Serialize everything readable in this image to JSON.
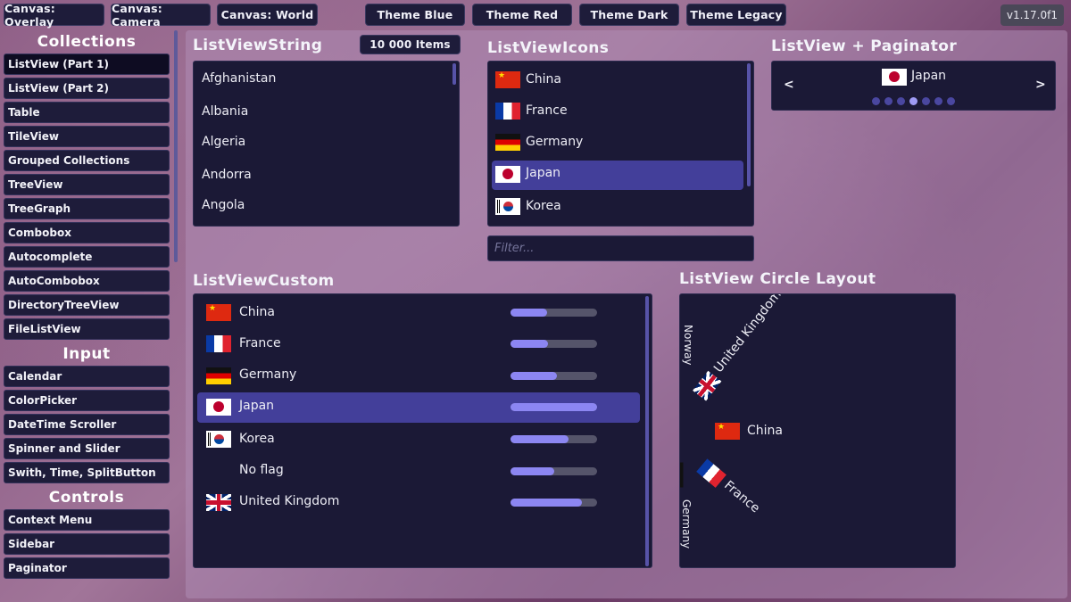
{
  "topbar": {
    "canvas_buttons": [
      "Canvas: Overlay",
      "Canvas: Camera",
      "Canvas: World"
    ],
    "theme_buttons": [
      "Theme Blue",
      "Theme Red",
      "Theme Dark",
      "Theme Legacy"
    ],
    "version": "v1.17.0f1"
  },
  "sidebar": {
    "collections_title": "Collections",
    "collections": [
      "ListView (Part 1)",
      "ListView (Part 2)",
      "Table",
      "TileView",
      "Grouped Collections",
      "TreeView",
      "TreeGraph",
      "Combobox",
      "Autocomplete",
      "AutoCombobox",
      "DirectoryTreeView",
      "FileListView"
    ],
    "input_title": "Input",
    "input": [
      "Calendar",
      "ColorPicker",
      "DateTime Scroller",
      "Spinner and Slider",
      "Swith, Time, SplitButton"
    ],
    "controls_title": "Controls",
    "controls": [
      "Context Menu",
      "Sidebar",
      "Paginator"
    ],
    "selected": "ListView (Part 1)"
  },
  "lv_string": {
    "title": "ListViewString",
    "items_button": "10 000 Items",
    "items": [
      "Afghanistan",
      "Albania",
      "Algeria",
      "Andorra",
      "Angola"
    ]
  },
  "lv_icons": {
    "title": "ListViewIcons",
    "items": [
      {
        "name": "China",
        "flag": "cn"
      },
      {
        "name": "France",
        "flag": "fr"
      },
      {
        "name": "Germany",
        "flag": "de"
      },
      {
        "name": "Japan",
        "flag": "jp"
      },
      {
        "name": "Korea",
        "flag": "kr"
      }
    ],
    "selected": "Japan",
    "filter_placeholder": "Filter..."
  },
  "lv_paginator": {
    "title": "ListView + Paginator",
    "prev": "<",
    "next": ">",
    "current": {
      "name": "Japan",
      "flag": "jp"
    },
    "pages": 7,
    "active_page": 4
  },
  "lv_custom": {
    "title": "ListViewCustom",
    "items": [
      {
        "name": "China",
        "flag": "cn",
        "progress": 0.42
      },
      {
        "name": "France",
        "flag": "fr",
        "progress": 0.43
      },
      {
        "name": "Germany",
        "flag": "de",
        "progress": 0.54
      },
      {
        "name": "Japan",
        "flag": "jp",
        "progress": 1.0
      },
      {
        "name": "Korea",
        "flag": "kr",
        "progress": 0.67
      },
      {
        "name": "No flag",
        "flag": "",
        "progress": 0.51
      },
      {
        "name": "United Kingdom",
        "flag": "uk",
        "progress": 0.82
      }
    ],
    "selected": "Japan"
  },
  "lv_circle": {
    "title": "ListView Circle Layout",
    "items": [
      "Norway",
      "United Kingdom",
      "China",
      "France",
      "Germany"
    ]
  },
  "colors": {
    "panel": "#1b1936",
    "selected": "#433f9a",
    "bar_fill": "#8c86f2",
    "bar_track": "#55546a"
  }
}
